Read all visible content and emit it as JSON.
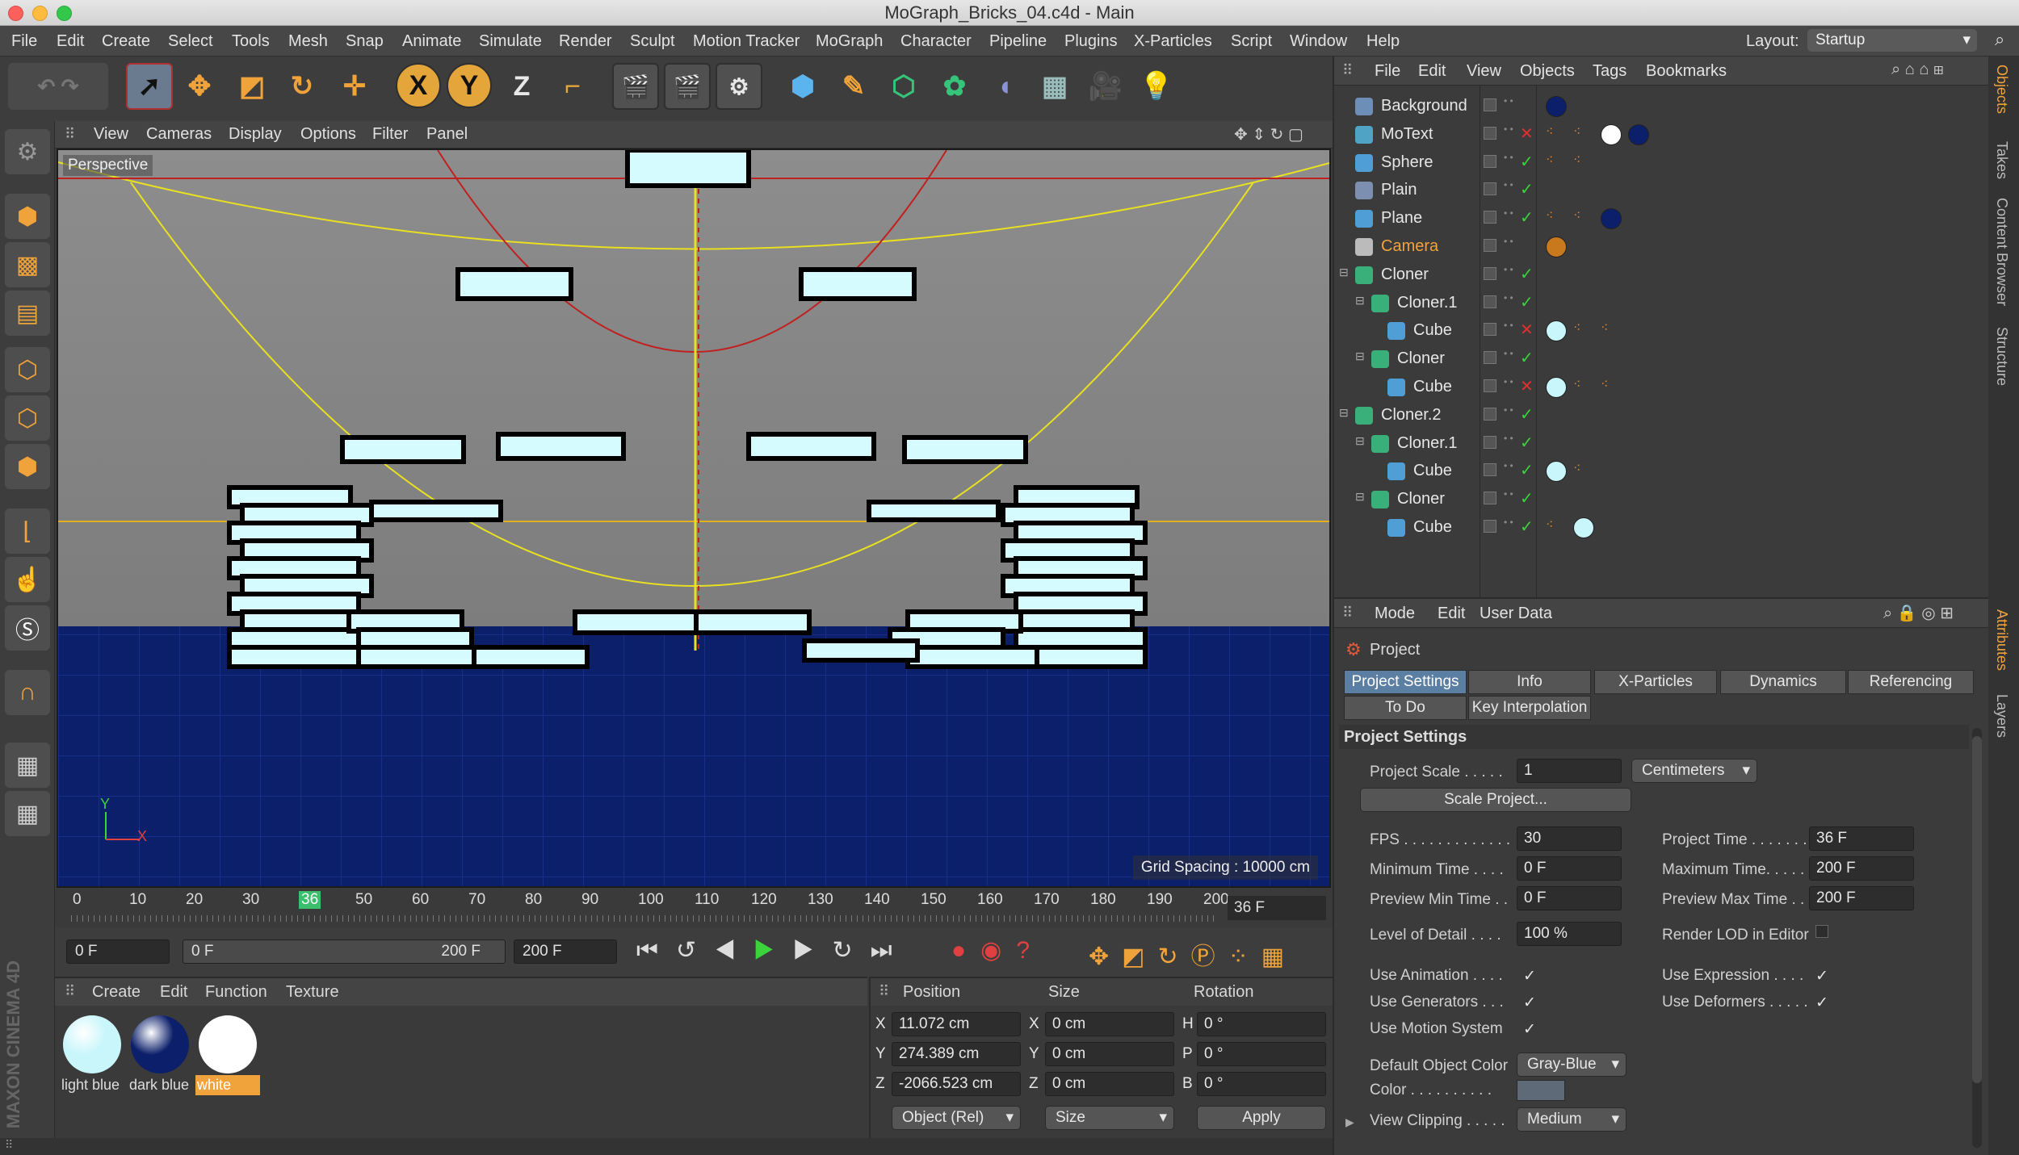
{
  "window": {
    "title": "MoGraph_Bricks_04.c4d - Main"
  },
  "menu": [
    "File",
    "Edit",
    "Create",
    "Select",
    "Tools",
    "Mesh",
    "Snap",
    "Animate",
    "Simulate",
    "Render",
    "Sculpt",
    "Motion Tracker",
    "MoGraph",
    "Character",
    "Pipeline",
    "Plugins",
    "X-Particles",
    "Script",
    "Window",
    "Help"
  ],
  "layout": {
    "label": "Layout:",
    "value": "Startup"
  },
  "toolbar_letters": {
    "x": "X",
    "y": "Y",
    "z": "Z"
  },
  "viewport": {
    "menu": [
      "View",
      "Cameras",
      "Display",
      "Options",
      "Filter",
      "Panel"
    ],
    "label": "Perspective",
    "grid": "Grid Spacing : 10000 cm",
    "axis_y": "Y",
    "axis_x": "X"
  },
  "timeline": {
    "ticks": [
      "0",
      "10",
      "20",
      "30",
      "36",
      "50",
      "60",
      "70",
      "80",
      "90",
      "100",
      "110",
      "120",
      "130",
      "140",
      "150",
      "160",
      "170",
      "180",
      "190",
      "200"
    ],
    "current": "36 F"
  },
  "transport": {
    "start": "0 F",
    "range_start": "0 F",
    "range_end": "200 F",
    "end": "200 F"
  },
  "materials": {
    "menu": [
      "Create",
      "Edit",
      "Function",
      "Texture"
    ],
    "items": [
      {
        "name": "light blue",
        "color": "#c9f6fb"
      },
      {
        "name": "dark blue",
        "color": "#0c1f6b"
      },
      {
        "name": "white",
        "color": "#ffffff"
      }
    ]
  },
  "coords": {
    "headers": {
      "position": "Position",
      "size": "Size",
      "rotation": "Rotation"
    },
    "rows": [
      {
        "axis": "X",
        "pos": "11.072 cm",
        "saxis": "X",
        "size": "0 cm",
        "raxis": "H",
        "rot": "0 °"
      },
      {
        "axis": "Y",
        "pos": "274.389 cm",
        "saxis": "Y",
        "size": "0 cm",
        "raxis": "P",
        "rot": "0 °"
      },
      {
        "axis": "Z",
        "pos": "-2066.523 cm",
        "saxis": "Z",
        "size": "0 cm",
        "raxis": "B",
        "rot": "0 °"
      }
    ],
    "mode": "Object (Rel)",
    "size_mode": "Size",
    "apply": "Apply"
  },
  "objects": {
    "menu": [
      "File",
      "Edit",
      "View",
      "Objects",
      "Tags",
      "Bookmarks"
    ],
    "rows": [
      {
        "name": "Background",
        "indent": 0,
        "icon": "#6d8fb7",
        "check": "",
        "tags": [
          "#0c1f6b"
        ]
      },
      {
        "name": "MoText",
        "indent": 0,
        "icon": "#4fa3c4",
        "check": "✕",
        "tags": [
          "dots",
          "dots",
          "#ffffff",
          "#0c1f6b"
        ]
      },
      {
        "name": "Sphere",
        "indent": 0,
        "icon": "#4f9fd6",
        "check": "✓",
        "tags": [
          "dots",
          "dots"
        ]
      },
      {
        "name": "Plain",
        "indent": 0,
        "icon": "#7d8fb0",
        "check": "✓",
        "tags": []
      },
      {
        "name": "Plane",
        "indent": 0,
        "icon": "#4f9fd6",
        "check": "✓",
        "tags": [
          "dots",
          "dots",
          "#0c1f6b"
        ]
      },
      {
        "name": "Camera",
        "indent": 0,
        "icon": "#bbbbbb",
        "check": "",
        "tags": [
          "camtag"
        ],
        "highlight": true
      },
      {
        "name": "Cloner",
        "indent": 0,
        "icon": "#39b07a",
        "check": "✓",
        "tags": []
      },
      {
        "name": "Cloner.1",
        "indent": 1,
        "icon": "#39b07a",
        "check": "✓",
        "tags": []
      },
      {
        "name": "Cube",
        "indent": 2,
        "icon": "#4f9fd6",
        "check": "✕",
        "tags": [
          "#c9f6fb",
          "dots",
          "dots"
        ]
      },
      {
        "name": "Cloner",
        "indent": 1,
        "icon": "#39b07a",
        "check": "✓",
        "tags": []
      },
      {
        "name": "Cube",
        "indent": 2,
        "icon": "#4f9fd6",
        "check": "✕",
        "tags": [
          "#c9f6fb",
          "dots",
          "dots"
        ]
      },
      {
        "name": "Cloner.2",
        "indent": 0,
        "icon": "#39b07a",
        "check": "✓",
        "tags": []
      },
      {
        "name": "Cloner.1",
        "indent": 1,
        "icon": "#39b07a",
        "check": "✓",
        "tags": []
      },
      {
        "name": "Cube",
        "indent": 2,
        "icon": "#4f9fd6",
        "check": "✓",
        "tags": [
          "#c9f6fb",
          "dots"
        ]
      },
      {
        "name": "Cloner",
        "indent": 1,
        "icon": "#39b07a",
        "check": "✓",
        "tags": []
      },
      {
        "name": "Cube",
        "indent": 2,
        "icon": "#4f9fd6",
        "check": "✓",
        "tags": [
          "dots",
          "#c9f6fb"
        ]
      }
    ]
  },
  "attributes": {
    "menu": [
      "Mode",
      "Edit",
      "User Data"
    ],
    "object": "Project",
    "tabs": [
      "Project Settings",
      "Info",
      "X-Particles",
      "Dynamics",
      "Referencing"
    ],
    "tabs2": [
      "To Do",
      "Key Interpolation"
    ],
    "section": "Project Settings",
    "project_scale": {
      "label": "Project Scale . . . . .",
      "value": "1",
      "unit": "Centimeters"
    },
    "scale_button": "Scale Project...",
    "left": [
      {
        "label": "FPS . . . . . . . . . . . . .",
        "value": "30"
      },
      {
        "label": "Minimum Time . . . .",
        "value": "0 F"
      },
      {
        "label": "Preview Min Time . .",
        "value": "0 F"
      }
    ],
    "right": [
      {
        "label": "Project Time . . . . . . .",
        "value": "36 F"
      },
      {
        "label": "Maximum Time. . . . .",
        "value": "200 F"
      },
      {
        "label": "Preview Max Time . .",
        "value": "200 F"
      }
    ],
    "lod": {
      "label": "Level of Detail . . . .",
      "value": "100 %",
      "render_lod": "Render LOD in Editor"
    },
    "flags": [
      {
        "label": "Use Animation . . . .",
        "mark": "✓"
      },
      {
        "label": "Use Generators . . .",
        "mark": "✓"
      },
      {
        "label": "Use Motion System",
        "mark": "✓"
      }
    ],
    "flags_right": [
      {
        "label": "Use Expression . . . .",
        "mark": "✓"
      },
      {
        "label": "Use Deformers . . . . .",
        "mark": "✓"
      }
    ],
    "default_color": {
      "label": "Default Object Color",
      "value": "Gray-Blue"
    },
    "color_label": "Color . . . . . . . . . .",
    "view_clipping": {
      "label": "View Clipping . . . . .",
      "value": "Medium"
    }
  },
  "sidetabs": [
    "Objects",
    "Takes",
    "Content Browser",
    "Structure",
    "Attributes",
    "Layers"
  ],
  "brand": "MAXON CINEMA 4D"
}
